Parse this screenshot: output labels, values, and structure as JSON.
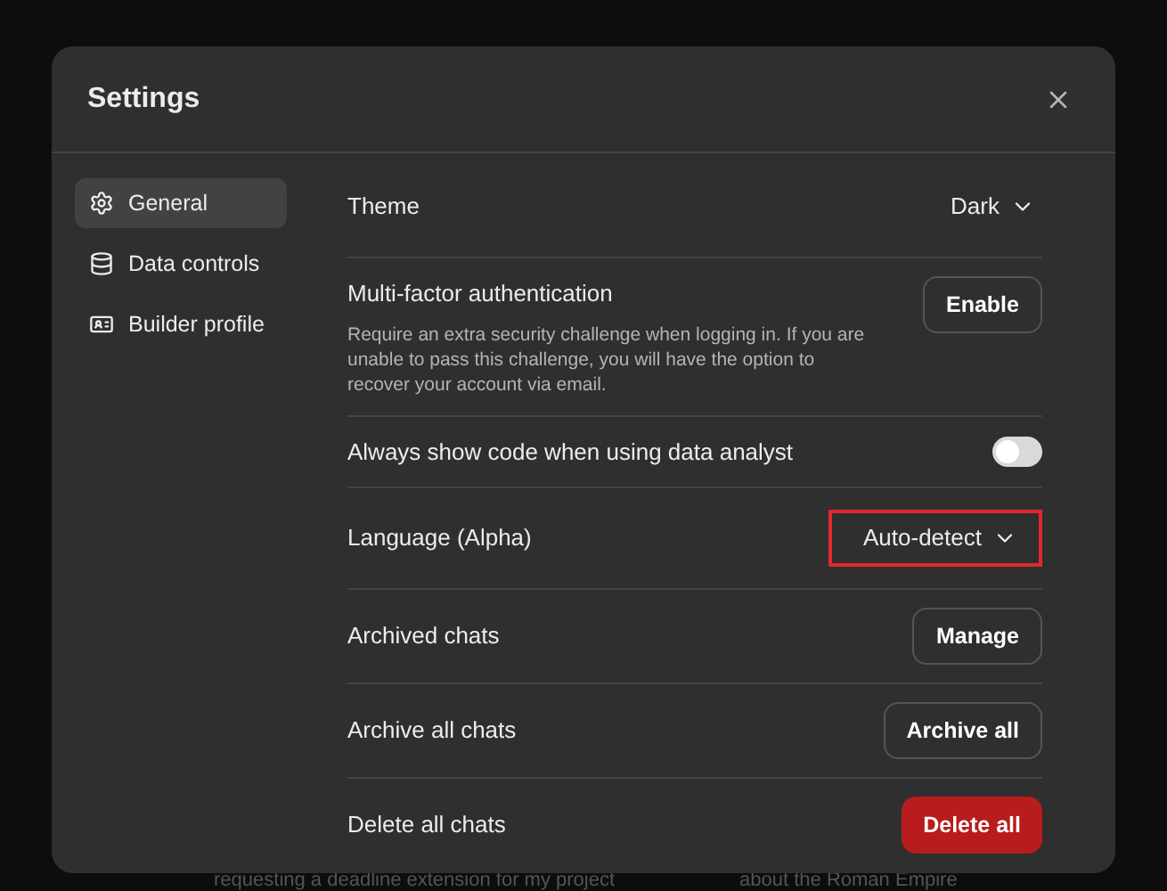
{
  "background": {
    "texts": [
      "requesting a deadline extension for my project",
      "about the Roman Empire"
    ]
  },
  "dialog": {
    "title": "Settings",
    "sidebar": {
      "items": [
        {
          "label": "General",
          "selected": true
        },
        {
          "label": "Data controls",
          "selected": false
        },
        {
          "label": "Builder profile",
          "selected": false
        }
      ]
    },
    "rows": [
      {
        "kind": "dropdown",
        "label": "Theme",
        "value": "Dark",
        "highlighted": false
      },
      {
        "kind": "button",
        "label": "Multi-factor authentication",
        "description": "Require an extra security challenge when logging in. If you are unable to pass this challenge, you will have the option to recover your account via email.",
        "button": "Enable"
      },
      {
        "kind": "toggle",
        "label": "Always show code when using data analyst",
        "on": false
      },
      {
        "kind": "dropdown",
        "label": "Language (Alpha)",
        "value": "Auto-detect",
        "highlighted": true
      },
      {
        "kind": "button",
        "label": "Archived chats",
        "button": "Manage"
      },
      {
        "kind": "button",
        "label": "Archive all chats",
        "button": "Archive all"
      },
      {
        "kind": "danger",
        "label": "Delete all chats",
        "button": "Delete all"
      }
    ]
  }
}
